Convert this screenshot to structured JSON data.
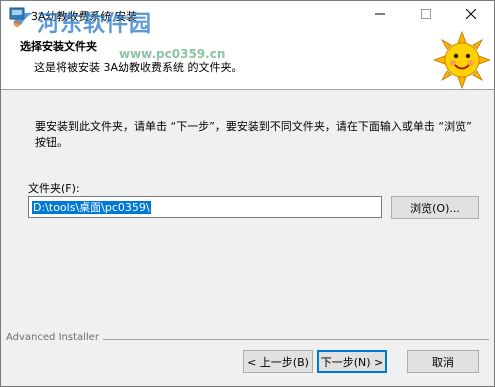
{
  "window": {
    "title": "3A幼教收费系统 安装"
  },
  "banner": {
    "title": "选择安装文件夹",
    "subtitle": "这是将被安装 3A幼教收费系统 的文件夹。"
  },
  "watermark": {
    "text": "河东软件园",
    "url": "www.pc0359.cn"
  },
  "body": {
    "instruction": "要安装到此文件夹，请单击 “下一步”，要安装到不同文件夹，请在下面输入或单击 “浏览” 按钮。",
    "folder_label": "文件夹(F):",
    "folder_value": "D:\\tools\\桌面\\pc0359\\",
    "browse_label": "浏览(O)..."
  },
  "footer": {
    "brand": "Advanced Installer",
    "back_label": "< 上一步(B)",
    "next_label": "下一步(N) >",
    "cancel_label": "取消"
  },
  "icons": {
    "app": "installer-app-icon",
    "minimize": "minimize-icon",
    "maximize": "maximize-icon",
    "close": "close-icon",
    "banner": "smiling-sun-icon"
  },
  "colors": {
    "selection": "#0078d7",
    "watermark": "#2878c8",
    "sun": "#ffd200"
  }
}
